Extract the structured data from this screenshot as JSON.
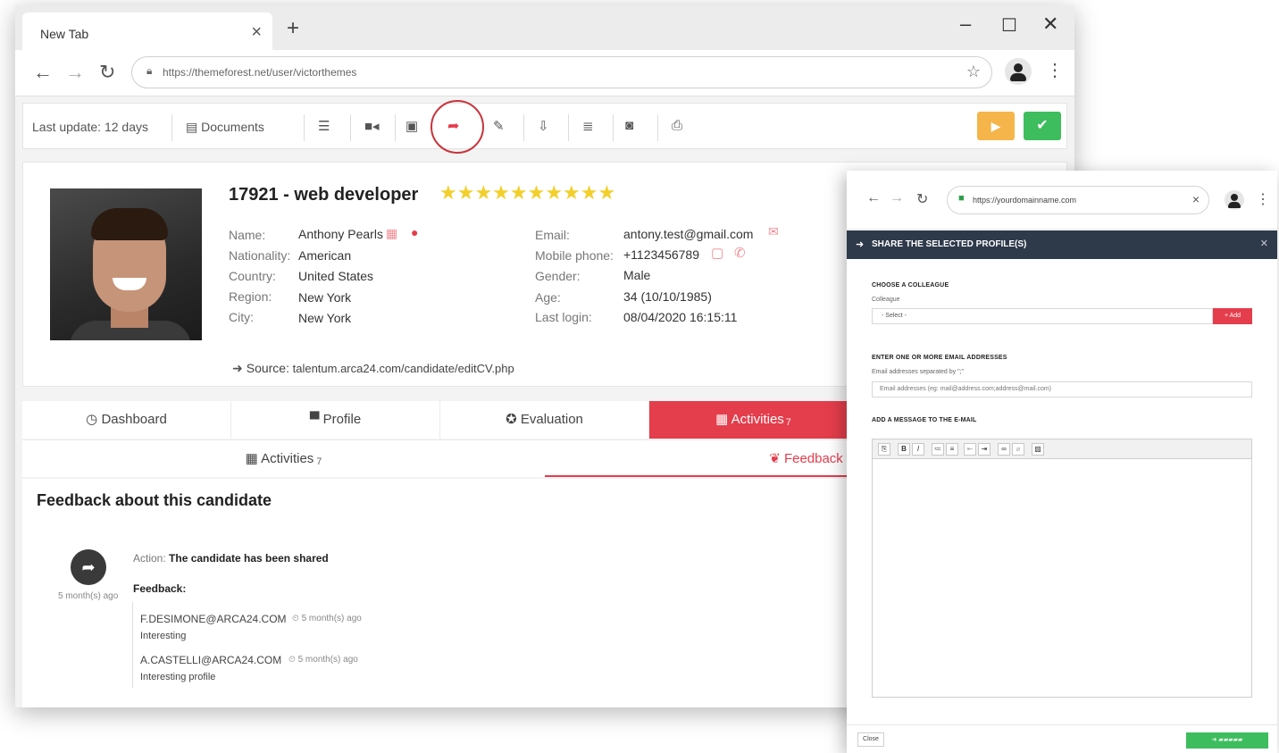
{
  "browser": {
    "tab_title": "New Tab",
    "tab_close": "×",
    "new_tab": "+",
    "minimize": "–",
    "maximize": "☐",
    "close": "✕",
    "url": "https://themeforest.net/user/victorthemes"
  },
  "toolbar": {
    "last_update": "Last update: 12 days",
    "documents": "Documents",
    "icons": [
      "list-icon",
      "video-icon",
      "form-icon",
      "share-icon",
      "pencil-icon",
      "export-icon",
      "archive-icon",
      "camera-icon",
      "print-icon"
    ]
  },
  "profile": {
    "title": "17921 - web developer",
    "stars": "★★★★★★★★★★",
    "labels": {
      "name": "Name:",
      "nationality": "Nationality:",
      "country": "Country:",
      "region": "Region:",
      "city": "City:",
      "email": "Email:",
      "mobile": "Mobile phone:",
      "gender": "Gender:",
      "age": "Age:",
      "last_login": "Last login:"
    },
    "values": {
      "name": "Anthony Pearls",
      "nationality": "American",
      "country": "United States",
      "region": "New York",
      "city": "New York",
      "email": "antony.test@gmail.com",
      "mobile": "+1123456789",
      "gender": "Male",
      "age": "34 (10/10/1985)",
      "last_login": "08/04/2020 16:15:11"
    },
    "source_label": "Source:",
    "source_value": "talentum.arca24.com/candidate/editCV.php"
  },
  "tabs_primary": [
    {
      "label": "Dashboard",
      "icon": "◷"
    },
    {
      "label": "Profile",
      "icon": "▀"
    },
    {
      "label": "Evaluation",
      "icon": "✪"
    },
    {
      "label": "Activities",
      "icon": "▦",
      "badge": "7"
    }
  ],
  "tabs_secondary": [
    {
      "label": "Activities",
      "icon": "▦",
      "badge": "7"
    },
    {
      "label": "Feedback",
      "icon": "❦"
    }
  ],
  "feedback": {
    "title": "Feedback about this candidate",
    "ago": "5 month(s) ago",
    "action_label": "Action:",
    "action_value": "The candidate has been shared",
    "feedback_label": "Feedback:",
    "entries": [
      {
        "email": "F.DESIMONE@ARCA24.COM",
        "time": "5 month(s) ago",
        "note": "Interesting"
      },
      {
        "email": "A.CASTELLI@ARCA24.COM",
        "time": "5 month(s) ago",
        "note": "Interesting profile"
      }
    ]
  },
  "popup": {
    "url": "https://yourdomainname.com",
    "modal_title": "SHARE THE SELECTED PROFILE(S)",
    "section1_title": "CHOOSE A COLLEAGUE",
    "section1_sub": "Colleague",
    "select_value": "- Select -",
    "add_label": "+ Add",
    "section2_title": "ENTER ONE OR MORE EMAIL ADDRESSES",
    "section2_sub": "Email addresses separated by \";\"",
    "email_placeholder": "Email addresses (eg: mail@address.com;address@mail.com)",
    "section3_title": "ADD A MESSAGE TO THE E-MAIL",
    "close_label": "Close"
  },
  "colors": {
    "accent": "#e43d4c",
    "confirm": "#3ebd5e",
    "warning": "#f5b54a",
    "modal_header": "#2e3a4a",
    "star": "#f3cf2b"
  }
}
